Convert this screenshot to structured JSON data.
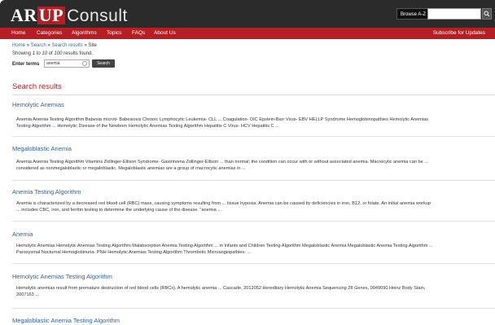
{
  "header": {
    "logo_prefix": "AR",
    "logo_up": "UP",
    "logo_suffix": "Consult",
    "browse_label": "Browse A-Z",
    "search_icon": "magnifier-icon"
  },
  "nav": {
    "items": [
      "Home",
      "Categories",
      "Algorithms",
      "Topics",
      "FAQs",
      "About Us"
    ],
    "subscribe": "Subscribe for Updates"
  },
  "breadcrumb": {
    "home": "Home",
    "search": "Search",
    "results": "Search results",
    "current": "Site",
    "separator": "»"
  },
  "showing": {
    "prefix": "Showing ",
    "range": "1 to 10",
    "middle": " of ",
    "total": "100",
    "suffix": " results found."
  },
  "form": {
    "label": "Enter terms",
    "value": "anemia",
    "button": "Search"
  },
  "results_heading": "Search results",
  "results": [
    {
      "title": "Hemolytic Anemias",
      "snippet_1": "Anemia Anemia Testing Algorithm Babesia microti- Babesiosis Chronic Lymphocytic Leukemia- CLL ... Coagulation- DIC Epstein-Barr Virus- EBV HELLP Syndrome Hemoglobinopathies Hemolytic Anemias",
      "snippet_2": "Testing Algorithm ... Hemolytic Disease of the Newborn Hemolytic Anemias Testing Algorithm Hepatitis C Virus- HCV Hepatitis C ..."
    },
    {
      "title": "Megaloblastic Anemia",
      "snippet_1": "Anemia Anemia Testing Algorithm Vitamins Zollinger-Ellison Syndrome- Gastrinoma Zollinger-Ellison ... than normal; the condition can occur with or without associated anemia. Macrocytic anemia can be ...",
      "snippet_2": "considered as nonmegaloblastic or megaloblastic. Megaloblastic anemias are a group of macrocytic anemias in ..."
    },
    {
      "title": "Anemia Testing Algorithm",
      "snippet_1": "Anemia is characterized by a decreased red blood cell (RBC) mass, causing symptoms resulting from ... tissue hypoxia. Anemia can be caused by deficiencies in iron, B12, or folate. An initial anemia workup",
      "snippet_2": "... includes CBC, iron, and ferritin testing to determine the underlying cause of the disease. \"anemia ..."
    },
    {
      "title": "Anemia",
      "snippet_1": "Hemolytic Anemias Hemolytic Anemias Testing Algorithm Malabsorption Anemia Testing Algorithm ... in Infants and Children Testing Algorithm Megaloblastic Anemia Megaloblastic Anemia Testing Algorithm ...",
      "snippet_2": "Paroxysmal Nocturnal Hemoglobinuria- PNH Hemolytic Anemias Testing Algorithm Thrombotic Microangiopathies- ..."
    },
    {
      "title": "Hemolytic Anemias Testing Algorithm",
      "snippet_1": "Hemolytic anemias result from premature destruction of red blood cells (RBCs). A hemolytic anemia ... Cascade, 2012052 Hereditary Hemolytic Anemia Sequencing 28 Genes, 0049090 Heinz Body Stain,",
      "snippet_2": "2007163 ..."
    },
    {
      "title": "Megaloblastic Anemia Testing Algorithm",
      "snippet_1": "",
      "snippet_2": ""
    }
  ],
  "colors": {
    "header_bg": "#2b2b2b",
    "nav_bg": "#b51f24",
    "link": "#2f62a6",
    "heading": "#b51f24"
  }
}
